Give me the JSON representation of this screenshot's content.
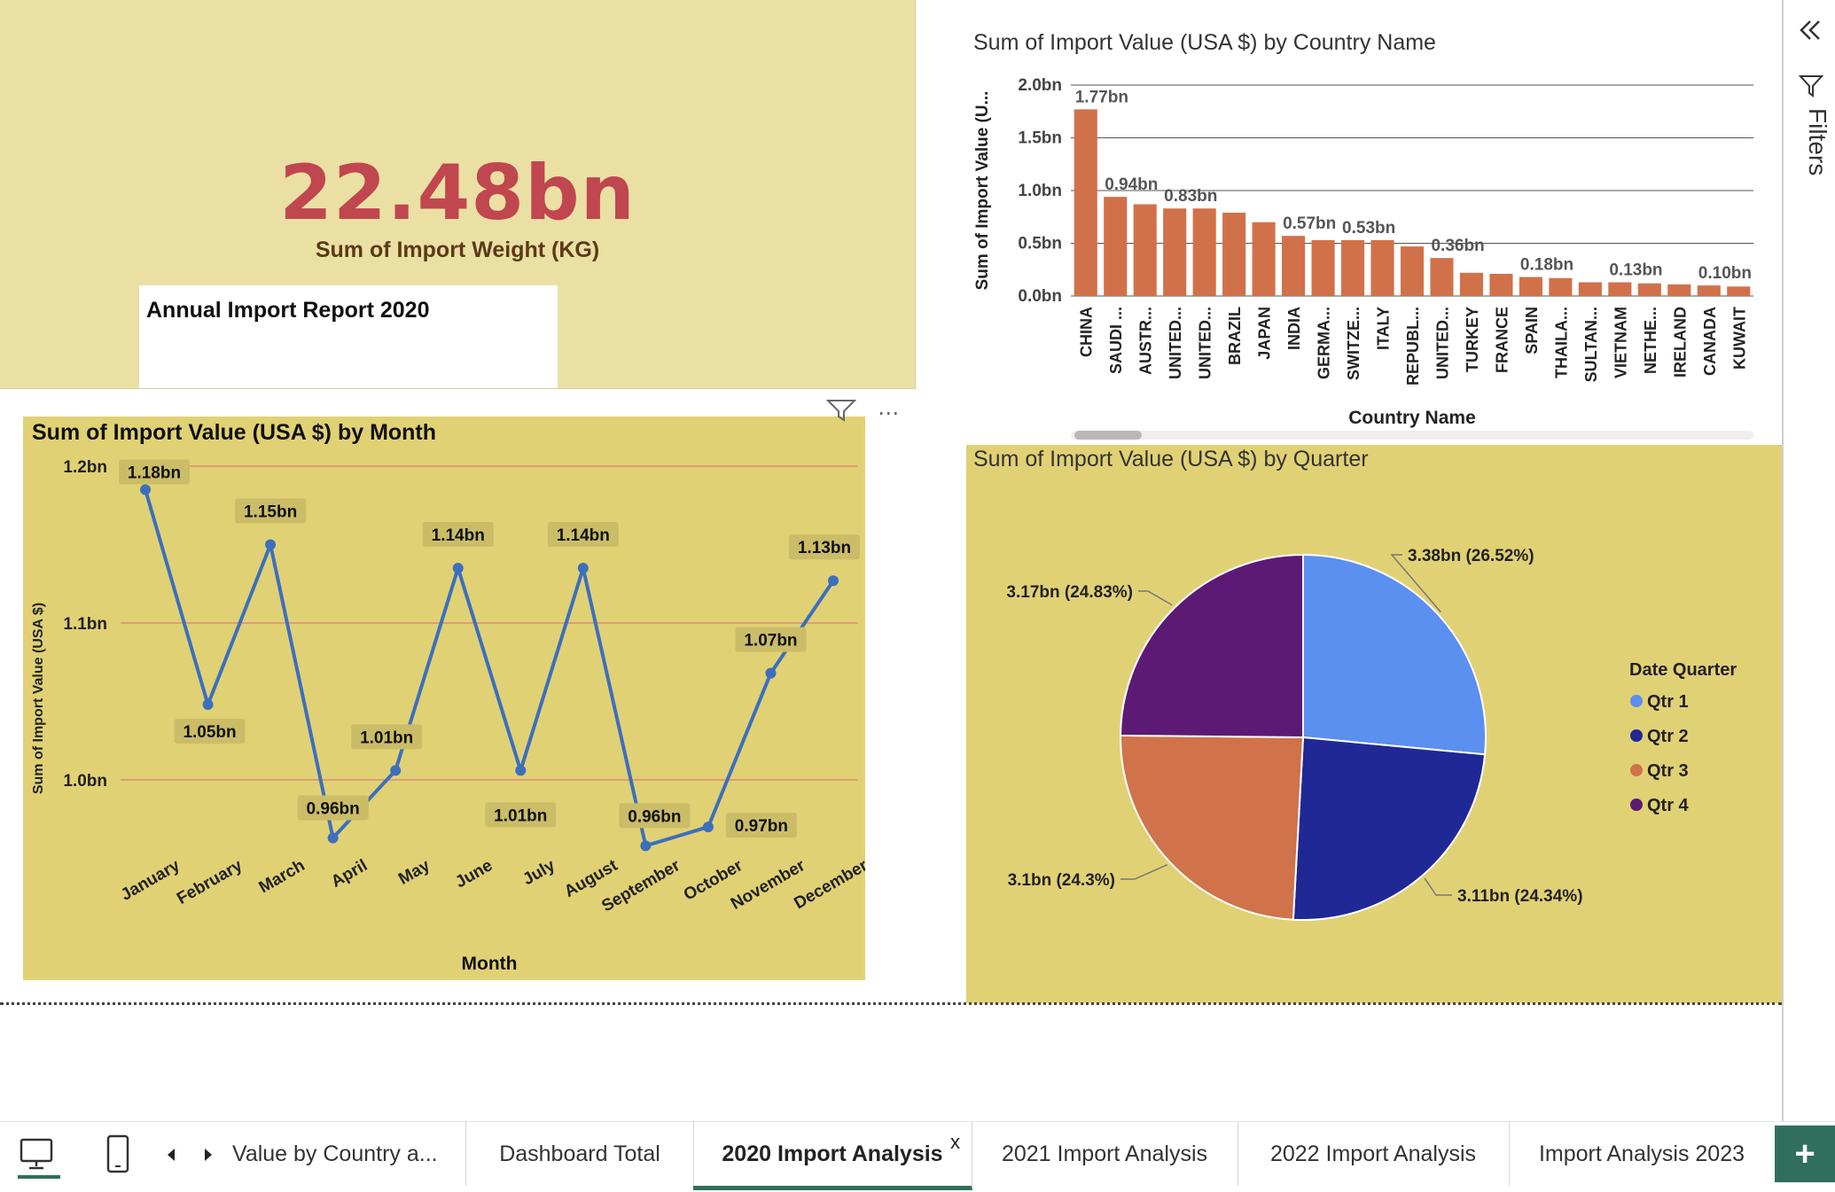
{
  "kpi": {
    "value": "22.48bn",
    "label": "Sum of Import Weight (KG)"
  },
  "report_box": {
    "title": "Annual Import Report 2020"
  },
  "filters_pane": {
    "label": "Filters"
  },
  "tabs": [
    {
      "label": "Value by Country a...",
      "active": false
    },
    {
      "label": "Dashboard Total",
      "active": false
    },
    {
      "label": "2020 Import Analysis",
      "active": true
    },
    {
      "label": "2021 Import Analysis",
      "active": false
    },
    {
      "label": "2022 Import Analysis",
      "active": false
    },
    {
      "label": "Import Analysis 2023",
      "active": false
    }
  ],
  "tab_close": "x",
  "add_page": "+",
  "chart_data": [
    {
      "type": "bar",
      "title": "Sum of Import Value (USA $) by Country Name",
      "xlabel": "Country Name",
      "ylabel": "Sum of Import Value (U...",
      "ylim": [
        0,
        2.0
      ],
      "yticks": [
        "0.0bn",
        "0.5bn",
        "1.0bn",
        "1.5bn",
        "2.0bn"
      ],
      "grid": true,
      "color": "#d1714a",
      "categories": [
        "CHINA",
        "SAUDI ...",
        "AUSTR...",
        "UNITED...",
        "UNITED...",
        "BRAZIL",
        "JAPAN",
        "INDIA",
        "GERMA...",
        "SWITZE...",
        "ITALY",
        "REPUBL...",
        "UNITED...",
        "TURKEY",
        "FRANCE",
        "SPAIN",
        "THAILA...",
        "SULTAN...",
        "VIETNAM",
        "NETHE...",
        "IRELAND",
        "CANADA",
        "KUWAIT"
      ],
      "values": [
        1.77,
        0.94,
        0.87,
        0.83,
        0.83,
        0.79,
        0.7,
        0.57,
        0.53,
        0.53,
        0.53,
        0.47,
        0.36,
        0.22,
        0.21,
        0.18,
        0.17,
        0.13,
        0.13,
        0.12,
        0.11,
        0.1,
        0.09
      ],
      "data_labels": [
        "1.77bn",
        "0.94bn",
        "",
        "0.83bn",
        "",
        "",
        "",
        "0.57bn",
        "",
        "0.53bn",
        "",
        "",
        "0.36bn",
        "",
        "",
        "0.18bn",
        "",
        "",
        "0.13bn",
        "",
        "",
        "0.10bn",
        ""
      ]
    },
    {
      "type": "line",
      "title": "Sum of Import Value (USA $) by Month",
      "xlabel": "Month",
      "ylabel": "Sum of Import Value (USA $)",
      "yticks": [
        "1.0bn",
        "1.1bn",
        "1.2bn"
      ],
      "ylim": [
        0.97,
        1.2
      ],
      "grid": true,
      "color": "#3c6fbd",
      "categories": [
        "January",
        "February",
        "March",
        "April",
        "May",
        "June",
        "July",
        "August",
        "September",
        "October",
        "November",
        "December"
      ],
      "values": [
        1.185,
        1.048,
        1.15,
        0.963,
        1.006,
        1.135,
        1.006,
        1.135,
        0.958,
        0.97,
        1.068,
        1.127
      ],
      "data_labels": [
        "1.18bn",
        "1.05bn",
        "1.15bn",
        "0.96bn",
        "1.01bn",
        "1.14bn",
        "1.01bn",
        "1.14bn",
        "0.96bn",
        "0.97bn",
        "1.07bn",
        "1.13bn"
      ]
    },
    {
      "type": "pie",
      "title": "Sum of Import Value (USA $) by Quarter",
      "legend_title": "Date Quarter",
      "legend_position": "right",
      "series": [
        {
          "name": "Qtr 1",
          "value": 3.38,
          "percent": 26.52,
          "label": "3.38bn (26.52%)",
          "color": "#5b8ff0"
        },
        {
          "name": "Qtr 2",
          "value": 3.11,
          "percent": 24.34,
          "label": "3.11bn (24.34%)",
          "color": "#202896"
        },
        {
          "name": "Qtr 3",
          "value": 3.1,
          "percent": 24.3,
          "label": "3.1bn (24.3%)",
          "color": "#d0734a"
        },
        {
          "name": "Qtr 4",
          "value": 3.17,
          "percent": 24.83,
          "label": "3.17bn (24.83%)",
          "color": "#5c1a74"
        }
      ]
    }
  ]
}
